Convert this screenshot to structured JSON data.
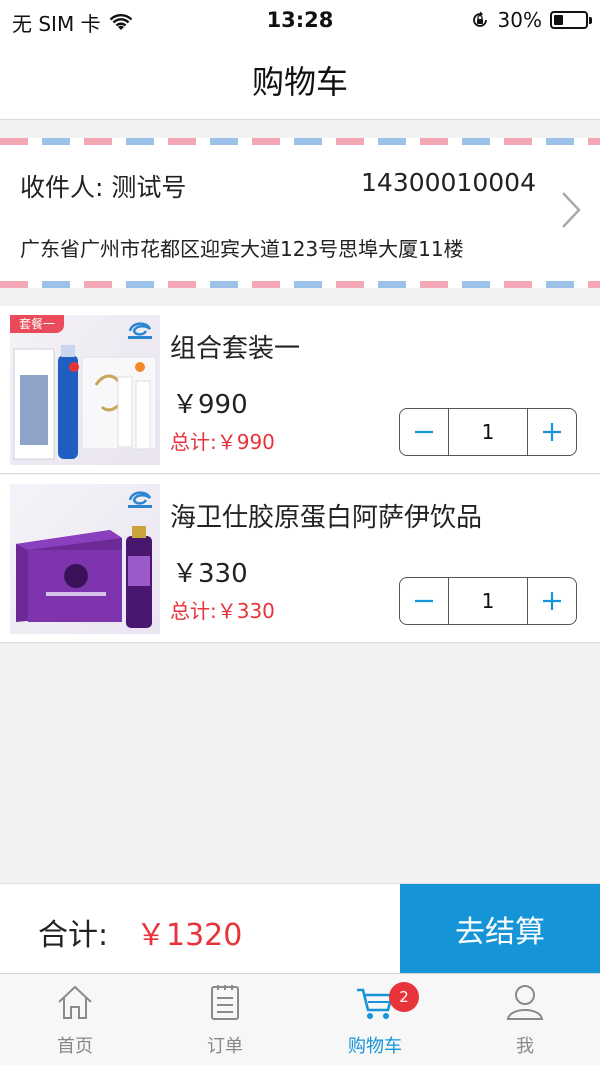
{
  "status_bar": {
    "carrier": "无 SIM 卡",
    "time": "13:28",
    "battery": "30%",
    "battery_level": 0.3
  },
  "nav": {
    "title": "购物车"
  },
  "address": {
    "receiver_label": "收件人: 测试号",
    "phone": "14300010004",
    "address": "广东省广州市花都区迎宾大道123号思埠大厦11楼"
  },
  "products": [
    {
      "tag": "套餐一",
      "name": "组合套装一",
      "price": "￥990",
      "subtotal": "总计:￥990",
      "quantity": "1"
    },
    {
      "tag": "",
      "name": "海卫仕胶原蛋白阿萨伊饮品",
      "price": "￥330",
      "subtotal": "总计:￥330",
      "quantity": "1"
    }
  ],
  "checkout": {
    "total_label": "合计:",
    "total_value": "￥1320",
    "button": "去结算"
  },
  "tabs": [
    {
      "label": "首页",
      "icon": "home-icon"
    },
    {
      "label": "订单",
      "icon": "order-icon"
    },
    {
      "label": "购物车",
      "icon": "cart-icon",
      "badge": "2"
    },
    {
      "label": "我",
      "icon": "profile-icon"
    }
  ],
  "colors": {
    "accent": "#1595d8",
    "price_red": "#e8333b",
    "tag_red": "#e94b5a"
  }
}
